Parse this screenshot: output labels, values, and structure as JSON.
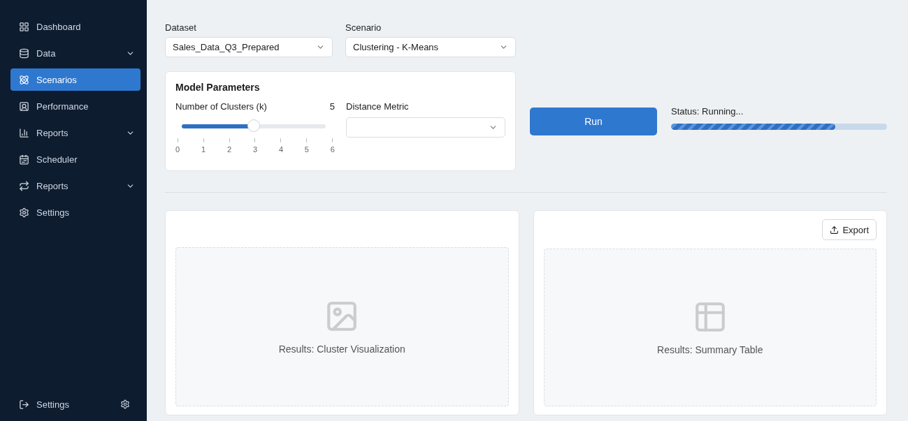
{
  "sidebar": {
    "items": [
      {
        "label": "Dashboard",
        "selected": false,
        "expandable": false
      },
      {
        "label": "Data",
        "selected": false,
        "expandable": true
      },
      {
        "label": "Scenarios",
        "selected": true,
        "expandable": false
      },
      {
        "label": "Performance",
        "selected": false,
        "expandable": false
      },
      {
        "label": "Reports",
        "selected": false,
        "expandable": true
      },
      {
        "label": "Scheduler",
        "selected": false,
        "expandable": false
      },
      {
        "label": "Reports",
        "selected": false,
        "expandable": true
      },
      {
        "label": "Settings",
        "selected": false,
        "expandable": false
      }
    ],
    "footer": {
      "label": "Settings"
    }
  },
  "controls": {
    "dataset": {
      "label": "Dataset",
      "value": "Sales_Data_Q3_Prepared"
    },
    "scenario": {
      "label": "Scenario",
      "value": "Clustering - K-Means"
    }
  },
  "model_parameters": {
    "title": "Model Parameters",
    "clusters": {
      "label": "Number of Clusters (k)",
      "value": "5",
      "level": 0.5,
      "ticks": [
        "0",
        "1",
        "2",
        "3",
        "4",
        "5",
        "6"
      ]
    },
    "distance_metric": {
      "label": "Distance Metric"
    }
  },
  "run": {
    "button": "Run",
    "status": "Status: Running...",
    "level": 0.76
  },
  "panels": [
    {
      "kind": "image",
      "caption": "Results: Cluster Visualization"
    },
    {
      "kind": "table",
      "caption": "Results: Summary Table",
      "action": "Export"
    }
  ]
}
